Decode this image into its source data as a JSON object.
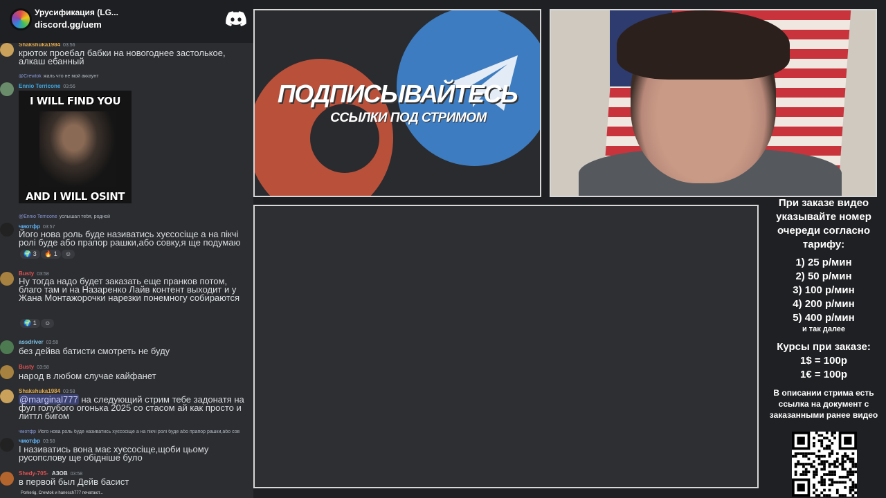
{
  "server": {
    "name": "Урусификация (LG...",
    "invite": "discord.gg/uem"
  },
  "chat": {
    "messages": [
      {
        "author": "Shakshuka1984",
        "time": "03:56",
        "author_color": "#e0a84a",
        "text": "крюток проебал бабки на новогоднее застолькое, алкаш ебанный"
      },
      {
        "reply_name": "@Crewtok",
        "reply_text": "жаль что не мой аккаунт",
        "author": "Ennio Terricone",
        "time": "03:56",
        "author_color": "#3fa7e0"
      },
      {
        "reply_name": "@Ennio Terricone",
        "reply_text": "услышал тебя, родной",
        "author": "чмотфр",
        "time": "03:57",
        "author_color": "#5fb3f5",
        "text": "Його нова роль буде називатись хуєсосіще а на пікчі ролі буде або прапор рашки,або совку,я ще подумаю",
        "reactions": [
          "3",
          "1"
        ]
      },
      {
        "author": "Busty",
        "time": "03:58",
        "author_color": "#e05151",
        "text": "Ну тогда надо будет заказать еще пранков потом, благо там и на Назаренко Лайв контент выходит и у Жана Монтажорочки нарезки понемногу собираются",
        "reactions": [
          "1"
        ]
      },
      {
        "author": "assdriver",
        "time": "03:58",
        "author_color": "#7fc4e8",
        "text": "без дейва батисти смотреть не буду"
      },
      {
        "author": "Busty",
        "time": "03:58",
        "author_color": "#e05151",
        "text": "народ в любом случае кайфанет"
      },
      {
        "author": "Shakshuka1984",
        "time": "03:58",
        "author_color": "#e0a84a",
        "mention": "@marginal777",
        "text": " на следующий стрим тебе задонатя на фул голубого огонька 2025 со стасом ай как просто и литтл бигом"
      },
      {
        "reply_name": "чмотфр",
        "reply_text": "Його нова роль буде називатись хуєсосіще а на пікчі ролі буде або прапор рашки,або сов",
        "author": "чмотфр",
        "time": "03:58",
        "author_color": "#5fb3f5",
        "text": "І називатись вона має хуєсосіще,щоби цьому русопслову ще обідніше було"
      },
      {
        "author": "Shedy-705-",
        "badge": "АЗОВ",
        "time": "03:58",
        "author_color": "#e05151",
        "text": "в первой был Дейв басист"
      }
    ],
    "meme": {
      "top": "I WILL FIND YOU",
      "bottom": "AND I WILL OSINT YOU"
    },
    "typing": "Porkerig, Crewtok и hanesch777 печатают..."
  },
  "promo": {
    "title": "ПОДПИСЫВАЙТЕСЬ",
    "subtitle": "ССЫЛКИ ПОД СТРИМОМ",
    "colors": {
      "patreon": "#b9503a",
      "telegram": "#3d7cc0"
    }
  },
  "info": {
    "heading": "При заказе видео указывайте номер очереди согласно тарифу:",
    "tariffs": [
      "1) 25 р/мин",
      "2) 50 р/мин",
      "3) 100 р/мин",
      "4) 200 р/мин",
      "5) 400 р/мин"
    ],
    "tariff_more": "и так далее",
    "rates_heading": "Курсы при заказе:",
    "rates": [
      "1$ = 100р",
      "1€ = 100р"
    ],
    "description_note": "В описании стрима есть ссылка на документ с заказанными ранее видео"
  }
}
